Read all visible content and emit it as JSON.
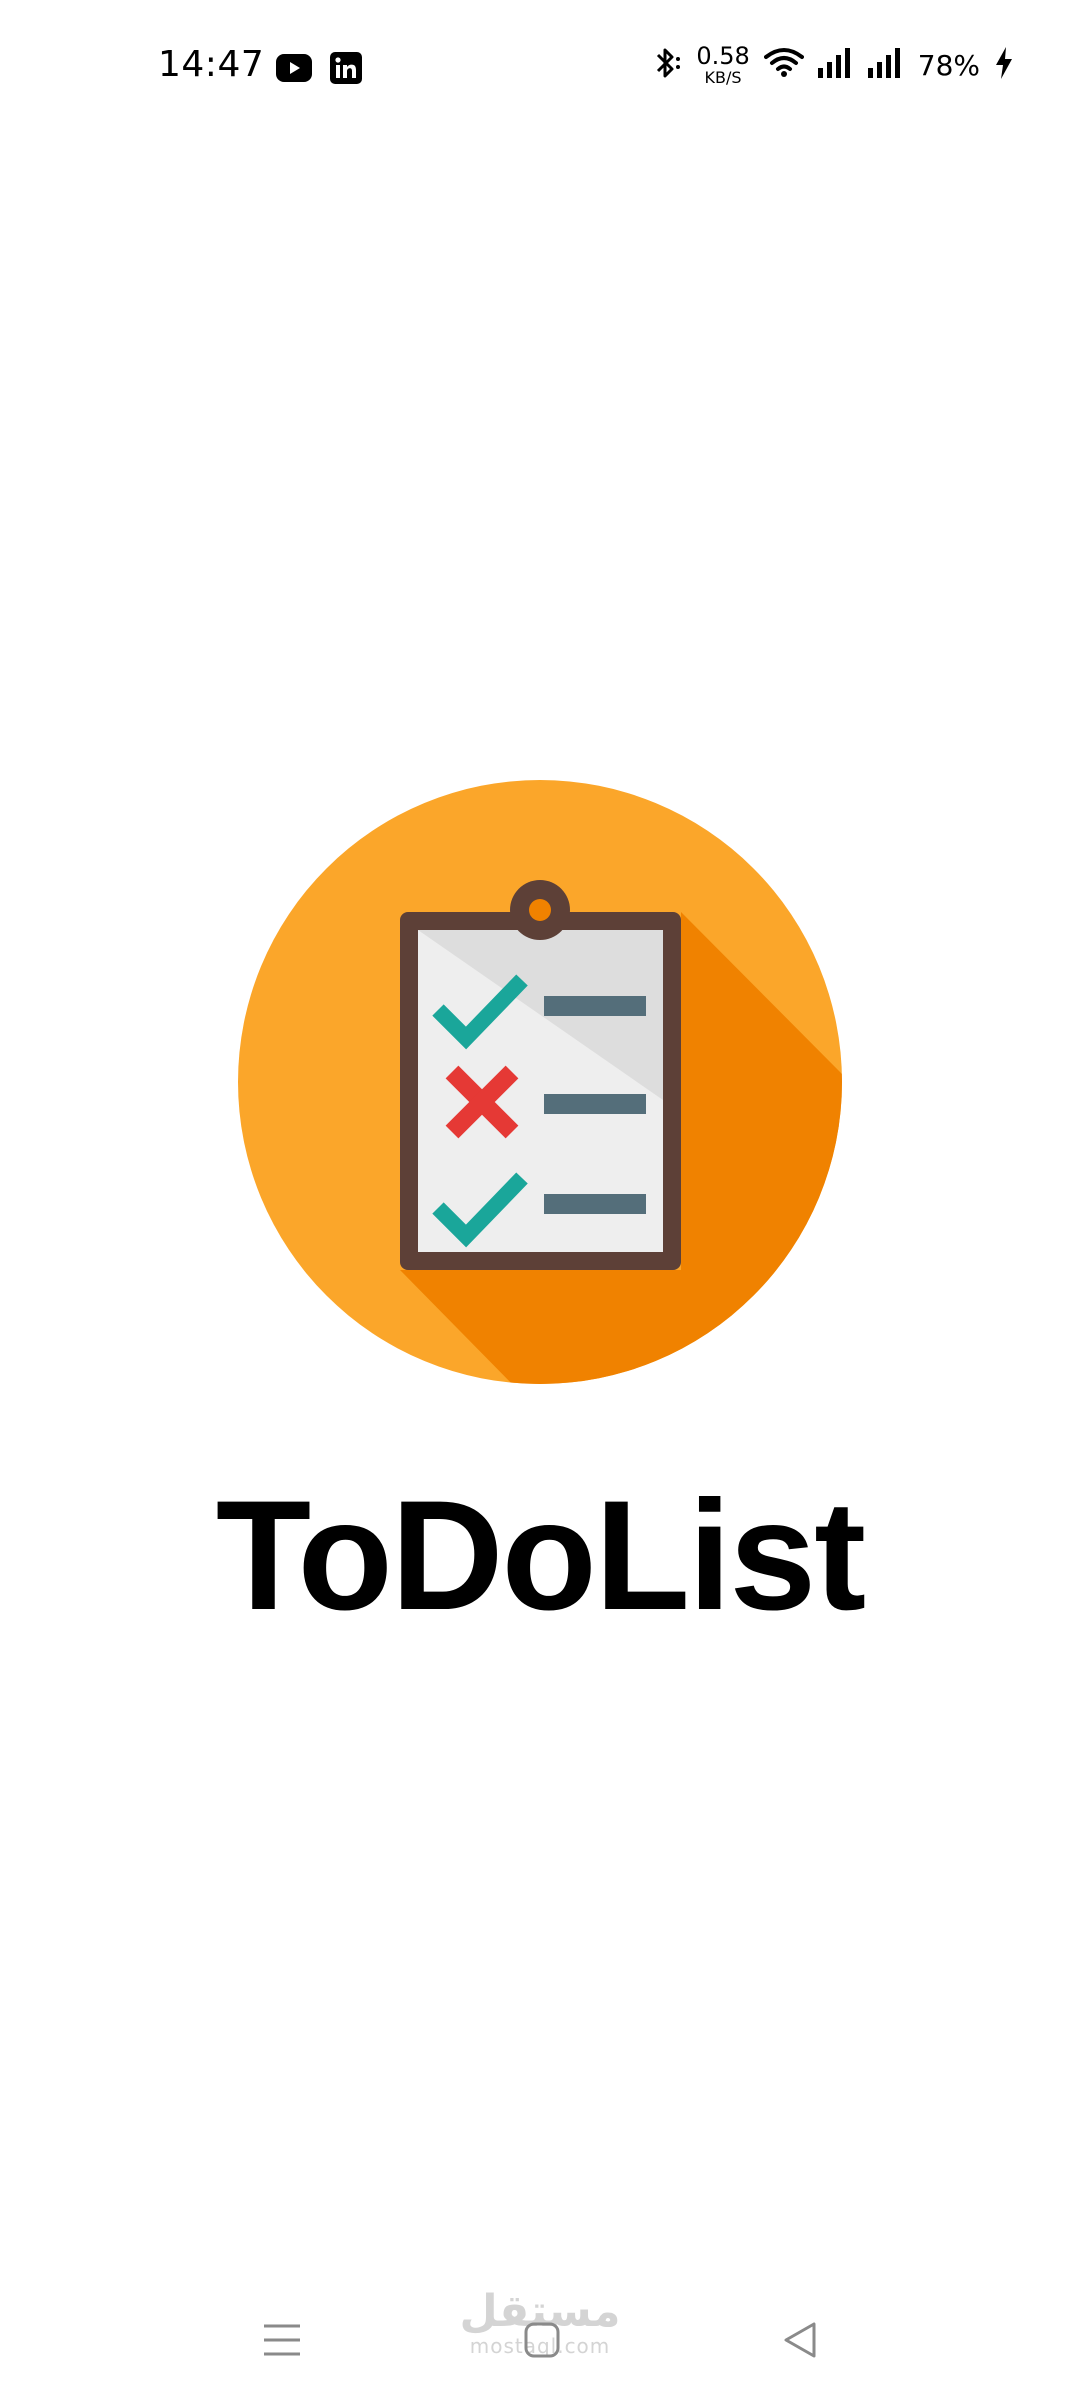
{
  "status_bar": {
    "time": "14:47",
    "notifications": [
      "youtube-icon",
      "linkedin-icon"
    ],
    "bluetooth_icon": "bluetooth-icon",
    "net_speed_value": "0.58",
    "net_speed_unit": "KB/S",
    "wifi_icon": "wifi-icon",
    "signal_icons": [
      "signal-icon",
      "signal-icon"
    ],
    "battery_percent": "78%",
    "charging_icon": "charging-bolt-icon"
  },
  "splash": {
    "logo_icon": "clipboard-checklist-icon",
    "title": "ToDoList",
    "colors": {
      "circle": "#FBA62A",
      "shadow": "#F08200",
      "clipboard_frame": "#5D4037",
      "paper": "#EEEEEE",
      "check": "#1AA69A",
      "cross": "#E53935",
      "line": "#546E7A"
    }
  },
  "nav_bar": {
    "menu_icon": "menu-icon",
    "home_icon": "home-icon",
    "back_icon": "back-icon"
  },
  "watermark": {
    "arabic": "مستقل",
    "latin": "mostaql.com"
  }
}
